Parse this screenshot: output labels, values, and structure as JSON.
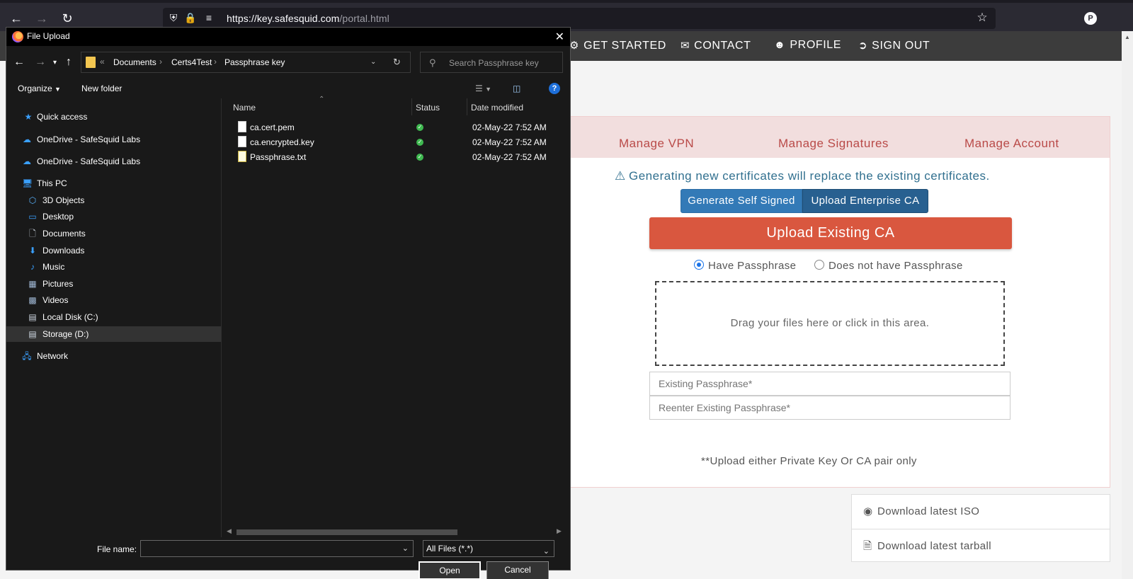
{
  "browser": {
    "url_host": "https://key.safesquid.com",
    "url_path": "/portal.html",
    "profile_initial": "P"
  },
  "portal": {
    "nav": [
      {
        "label": "GET STARTED",
        "icon": "gears-icon"
      },
      {
        "label": "CONTACT",
        "icon": "envelope-icon"
      },
      {
        "label": "PROFILE",
        "icon": "user-circle-icon"
      },
      {
        "label": "SIGN OUT",
        "icon": "sign-out-icon"
      }
    ],
    "tabs": [
      "Manage VPN",
      "Manage Signatures",
      "Manage Account"
    ],
    "warning": "Generating new certificates will replace the existing certificates.",
    "btn_generate": "Generate Self Signed",
    "btn_upload_enterprise": "Upload Enterprise CA",
    "upload_banner": "Upload Existing CA",
    "radio_have": "Have Passphrase",
    "radio_not_have": "Does not have Passphrase",
    "dropzone": "Drag your files here or click in this area.",
    "pass_placeholder": "Existing Passphrase*",
    "repass_placeholder": "Reenter Existing Passphrase*",
    "note": "**Upload either Private Key Or CA pair only",
    "download_iso": "Download latest ISO",
    "download_tarball": "Download latest tarball"
  },
  "dialog": {
    "title": "File Upload",
    "breadcrumb": [
      "Documents",
      "Certs4Test",
      "Passphrase key"
    ],
    "search_placeholder": "Search Passphrase key",
    "organize": "Organize",
    "new_folder": "New folder",
    "sidebar": [
      {
        "label": "Quick access",
        "icon": "star-icon",
        "color": "#3aa0ff"
      },
      {
        "label": "OneDrive - SafeSquid Labs",
        "icon": "cloud-icon",
        "color": "#3aa0ff"
      },
      {
        "label": "OneDrive - SafeSquid Labs",
        "icon": "cloud-icon",
        "color": "#3aa0ff"
      },
      {
        "label": "This PC",
        "icon": "computer-icon",
        "color": "#3aa0ff"
      },
      {
        "label": "3D Objects",
        "icon": "cube-icon",
        "color": "#5ab4ff"
      },
      {
        "label": "Desktop",
        "icon": "desktop-icon",
        "color": "#3aa0ff"
      },
      {
        "label": "Documents",
        "icon": "document-icon",
        "color": "#cfd8e3"
      },
      {
        "label": "Downloads",
        "icon": "download-icon",
        "color": "#3aa0ff"
      },
      {
        "label": "Music",
        "icon": "music-icon",
        "color": "#3aa0ff"
      },
      {
        "label": "Pictures",
        "icon": "picture-icon",
        "color": "#9fb7d4"
      },
      {
        "label": "Videos",
        "icon": "video-icon",
        "color": "#9fb7d4"
      },
      {
        "label": "Local Disk (C:)",
        "icon": "drive-icon",
        "color": "#cfd8e3"
      },
      {
        "label": "Storage (D:)",
        "icon": "drive-icon",
        "color": "#cfd8e3"
      },
      {
        "label": "Network",
        "icon": "network-icon",
        "color": "#3aa0ff"
      }
    ],
    "columns": [
      "Name",
      "Status",
      "Date modified"
    ],
    "files": [
      {
        "name": "ca.cert.pem",
        "date": "02-May-22 7:52 AM",
        "type": "file"
      },
      {
        "name": "ca.encrypted.key",
        "date": "02-May-22 7:52 AM",
        "type": "file"
      },
      {
        "name": "Passphrase.txt",
        "date": "02-May-22 7:52 AM",
        "type": "txt"
      }
    ],
    "file_name_label": "File name:",
    "file_name_value": "",
    "filter": "All Files (*.*)",
    "open": "Open",
    "cancel": "Cancel"
  }
}
